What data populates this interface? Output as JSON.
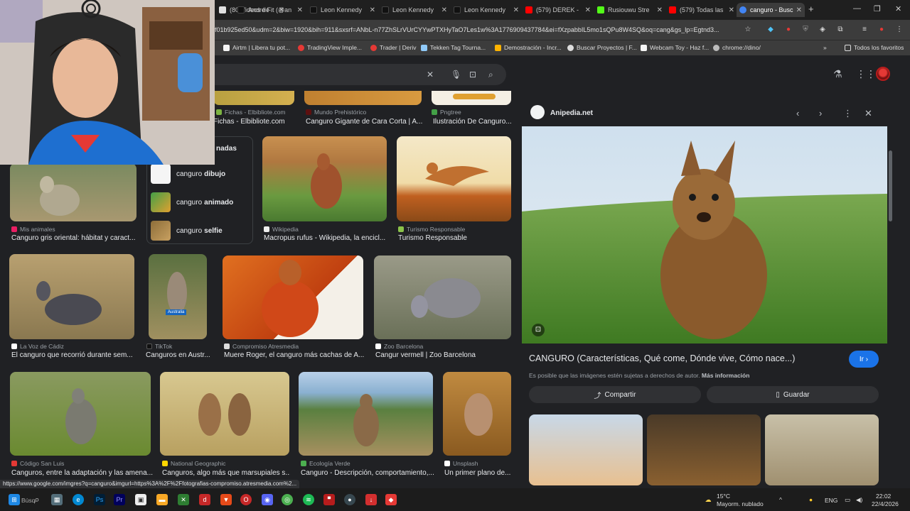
{
  "browser": {
    "tabs": [
      {
        "label": "(80)Videos de",
        "color": "#e0e0e0"
      },
      {
        "label": "André Fit (@an",
        "color": "#111111"
      },
      {
        "label": "Leon Kennedy",
        "color": "#111111"
      },
      {
        "label": "Leon Kennedy",
        "color": "#111111"
      },
      {
        "label": "(579) DEREK -",
        "color": "#ff0000"
      },
      {
        "label": "Rusiouwu Stre",
        "color": "#53fc18"
      },
      {
        "label": "(579) Todas las",
        "color": "#ff0000"
      },
      {
        "label": "canguro - Busc",
        "color": "#4285f4"
      }
    ],
    "new_tab": "+",
    "url": "f01b925ed50&udm=2&biw=1920&bih=911&sxsrf=ANbL-n77ZhSLrVUrCYYwPTXHyTaO7Les1w%3A1776909437784&ei=fXzpabbIL5mo1sQPu8W4SQ&oq=cang&gs_lp=Egtnd3...",
    "bookmarks": [
      "Airtm | Libera tu pot...",
      "TradingView Imple...",
      "Trader | Deriv",
      "Tekken Tag Tourna...",
      "Demostración - Incr...",
      "Buscar Proyectos | F...",
      "Webcam Toy - Haz f...",
      "chrome://dino/"
    ],
    "bookmarks_other": "Todos los favoritos"
  },
  "results": {
    "top_row": [
      {
        "source": "Fichas - Elbibliote.com",
        "caption": "Fichas - Elbibliote.com"
      },
      {
        "source": "Mundo Prehistórico",
        "caption": "Canguro Gigante de Cara Corta | A..."
      },
      {
        "source": "Pngtree",
        "caption": "Ilustración De Canguro..."
      }
    ],
    "related_heading": "nadas",
    "related": [
      {
        "prefix": "canguro",
        "bold": "dibujo"
      },
      {
        "prefix": "canguro",
        "bold": "animado"
      },
      {
        "prefix": "canguro",
        "bold": "selfie"
      }
    ],
    "row2": [
      {
        "source": "Mis animales",
        "caption": "Canguro gris oriental: hábitat y caract..."
      },
      {
        "source": "Wikipedia",
        "caption": "Macropus rufus - Wikipedia, la encicl..."
      },
      {
        "source": "Turismo Responsable",
        "caption": "Turismo Responsable"
      }
    ],
    "row3": [
      {
        "source": "La Voz de Cádiz",
        "caption": "El canguro que recorrió durante sem..."
      },
      {
        "source": "TikTok",
        "caption": "Canguros en Austr..."
      },
      {
        "source": "Compromiso Atresmedia",
        "caption": "Muere Roger, el canguro más cachas de A..."
      },
      {
        "source": "Zoo Barcelona",
        "caption": "Cangur vermell | Zoo Barcelona"
      }
    ],
    "row4": [
      {
        "source": "Código San Luis",
        "caption": "Canguros, entre la adaptación y las amena..."
      },
      {
        "source": "National Geographic",
        "caption": "Canguros, algo más que marsupiales s..."
      },
      {
        "source": "Ecología Verde",
        "caption": "Canguro - Descripción, comportamiento,..."
      },
      {
        "source": "Unsplash",
        "caption": "Un primer plano de..."
      }
    ],
    "tiktok_badge": "Australia"
  },
  "panel": {
    "site": "Anipedia.net",
    "title": "CANGURO (Características, Qué come, Dónde vive, Cómo nace...)",
    "go_label": "Ir ›",
    "note": "Es posible que las imágenes estén sujetas a derechos de autor.",
    "note_link": "Más información",
    "share_label": "Compartir",
    "save_label": "Guardar"
  },
  "status_url": "https://www.google.com/imgres?q=canguro&imgurl=https%3A%2F%2Ffotografias-compromiso.atresmedia.com%2...",
  "taskbar": {
    "search_text": "Búsq",
    "weather_temp": "15°C",
    "weather_desc": "Mayorm. nublado",
    "lang": "ENG",
    "time": "22:02",
    "date": "22/4/2026"
  }
}
